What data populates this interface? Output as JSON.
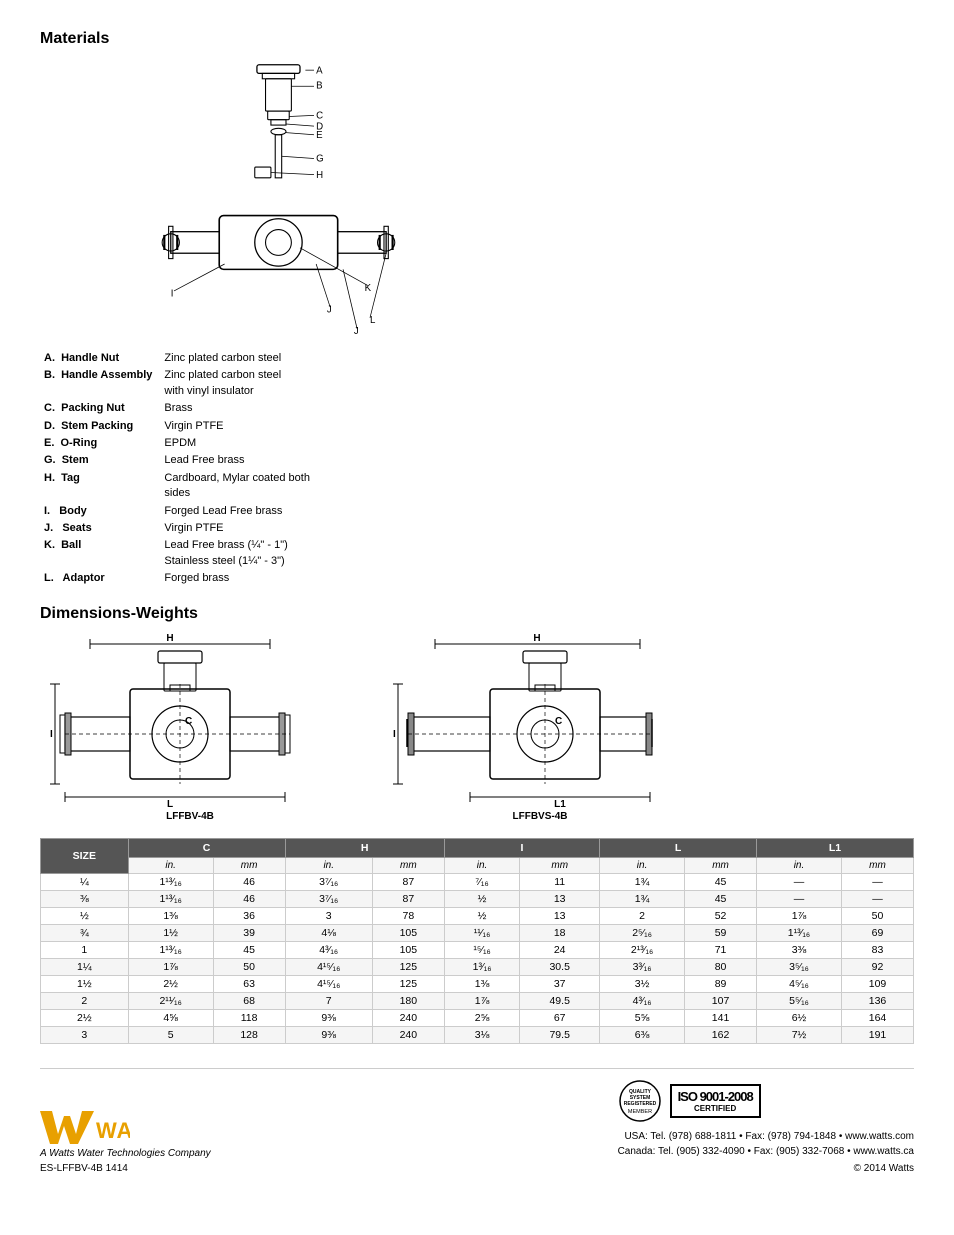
{
  "sections": {
    "materials": {
      "heading": "Materials",
      "items": [
        {
          "label": "A.",
          "name": "Handle Nut",
          "value": "Zinc plated carbon steel"
        },
        {
          "label": "B.",
          "name": "Handle Assembly",
          "value": "Zinc plated carbon steel with vinyl insulator"
        },
        {
          "label": "C.",
          "name": "Packing Nut",
          "value": "Brass"
        },
        {
          "label": "D.",
          "name": "Stem Packing",
          "value": "Virgin PTFE"
        },
        {
          "label": "E.",
          "name": "O-Ring",
          "value": "EPDM"
        },
        {
          "label": "G.",
          "name": "Stem",
          "value": "Lead Free brass"
        },
        {
          "label": "H.",
          "name": "Tag",
          "value": "Cardboard, Mylar coated both sides"
        },
        {
          "label": "I.",
          "name": "Body",
          "value": "Forged Lead Free brass"
        },
        {
          "label": "J.",
          "name": "Seats",
          "value": "Virgin PTFE"
        },
        {
          "label": "K.",
          "name": "Ball",
          "value": "Lead Free brass (¼\" - 1\") Stainless steel (1¼\" - 3\")"
        },
        {
          "label": "L.",
          "name": "Adaptor",
          "value": "Forged brass"
        }
      ]
    },
    "dimensions": {
      "heading": "Dimensions-Weights",
      "diagram1_label": "LFFBV-4B",
      "diagram2_label": "LFFBVS-4B",
      "table": {
        "columns": [
          "SIZE",
          "C",
          "",
          "H",
          "",
          "I",
          "",
          "L",
          "",
          "L1",
          ""
        ],
        "subheaders": [
          "in.",
          "in.",
          "mm",
          "in.",
          "mm",
          "in.",
          "mm",
          "in.",
          "mm",
          "in.",
          "mm"
        ],
        "rows": [
          [
            "¼",
            "1¹³⁄₁₆",
            "46",
            "3⁷⁄₁₆",
            "87",
            "⁷⁄₁₆",
            "11",
            "1¾",
            "45",
            "—",
            "—"
          ],
          [
            "⅜",
            "1¹³⁄₁₆",
            "46",
            "3⁷⁄₁₆",
            "87",
            "½",
            "13",
            "1¾",
            "45",
            "—",
            "—"
          ],
          [
            "½",
            "1⅜",
            "36",
            "3",
            "78",
            "½",
            "13",
            "2",
            "52",
            "1⅞",
            "50"
          ],
          [
            "¾",
            "1½",
            "39",
            "4⅛",
            "105",
            "¹¹⁄₁₆",
            "18",
            "2⅝₁₆",
            "59",
            "1¹³⁄₁₆",
            "69"
          ],
          [
            "1",
            "1¹³⁄₁₆",
            "45",
            "4⅜₁₆",
            "105",
            "¹⁵⁄₁₆",
            "24",
            "2¹³⁄₁₆",
            "71",
            "3⅜",
            "83"
          ],
          [
            "1¼",
            "1⅞",
            "50",
            "4¹⁵⁄₁₆",
            "125",
            "1³⁄₁₆",
            "30.5",
            "3⅜₁₆",
            "80",
            "3⅝₁₆",
            "92"
          ],
          [
            "1½",
            "2½",
            "63",
            "4¹⁵⁄₁₆",
            "125",
            "1⅜",
            "37",
            "3½",
            "89",
            "4⅝₁₆",
            "109"
          ],
          [
            "2",
            "2¹¹⁄₁₆",
            "68",
            "7",
            "180",
            "1⅞",
            "49.5",
            "4⅜₁₆",
            "107",
            "5⅝₁₆",
            "136"
          ],
          [
            "2½",
            "4⅝",
            "118",
            "9⅜",
            "240",
            "2⅝",
            "67",
            "5⅝",
            "141",
            "6½",
            "164"
          ],
          [
            "3",
            "5",
            "128",
            "9⅜",
            "240",
            "3⅛",
            "79.5",
            "6⅜",
            "162",
            "7½",
            "191"
          ]
        ]
      }
    },
    "footer": {
      "company": "A Watts Water Technologies Company",
      "docnum": "ES-LFFBV-4B  1414",
      "copyright": "© 2014 Watts",
      "iso": "ISO 9001-2008",
      "iso_sub": "CERTIFIED",
      "contact_usa": "USA: Tel. (978) 688-1811 • Fax: (978) 794-1848 • www.watts.com",
      "contact_canada": "Canada: Tel. (905) 332-4090 • Fax: (905) 332-7068 • www.watts.ca"
    }
  }
}
